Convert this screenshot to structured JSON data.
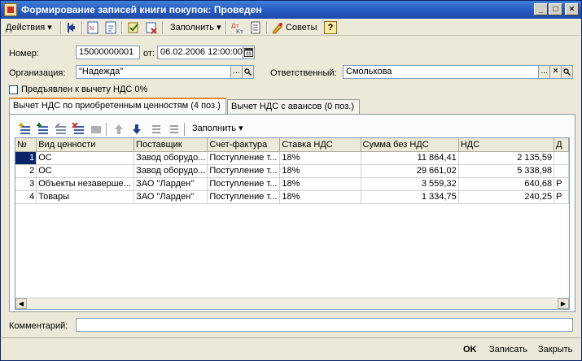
{
  "window": {
    "title": "Формирование записей книги покупок: Проведен",
    "controls": [
      "_",
      "□",
      "×"
    ]
  },
  "toolbar": {
    "actions_label": "Действия",
    "fill_label": "Заполнить",
    "tips_label": "Советы",
    "help_label": "?"
  },
  "header": {
    "number_label": "Номер:",
    "number_value": "15000000001",
    "date_label": "от:",
    "date_value": "06.02.2006 12:00:00",
    "org_label": "Организация:",
    "org_value": "\"Надежда\"",
    "responsible_label": "Ответственный:",
    "responsible_value": "Смолькова",
    "vat0_label": "Предъявлен к вычету НДС 0%",
    "ellipsis": "...",
    "clear": "×"
  },
  "tabs": [
    {
      "label": "Вычет НДС по приобретенным ценностям (4 поз.)"
    },
    {
      "label": "Вычет НДС с авансов (0 поз.)"
    }
  ],
  "inner_toolbar": {
    "fill_label": "Заполнить"
  },
  "table": {
    "columns": [
      "№",
      "Вид ценности",
      "Поставщик",
      "Счет-фактура",
      "Ставка НДС",
      "Сумма без НДС",
      "НДС",
      "Д"
    ],
    "rows": [
      {
        "n": "1",
        "kind": "ОС",
        "supplier": "Завод оборудо...",
        "invoice": "Поступление т...",
        "rate": "18%",
        "sum": "11 864,41",
        "vat": "2 135,59",
        "d": ""
      },
      {
        "n": "2",
        "kind": "ОС",
        "supplier": "Завод оборудо...",
        "invoice": "Поступление т...",
        "rate": "18%",
        "sum": "29 661,02",
        "vat": "5 338,98",
        "d": ""
      },
      {
        "n": "3",
        "kind": "Объекты незаверше...",
        "supplier": "ЗАО \"Ларден\"",
        "invoice": "Поступление т...",
        "rate": "18%",
        "sum": "3 559,32",
        "vat": "640,68",
        "d": "Р"
      },
      {
        "n": "4",
        "kind": "Товары",
        "supplier": "ЗАО \"Ларден\"",
        "invoice": "Поступление т...",
        "rate": "18%",
        "sum": "1 334,75",
        "vat": "240,25",
        "d": "Р"
      }
    ]
  },
  "comment_label": "Комментарий:",
  "comment_value": "",
  "footer": {
    "ok": "OK",
    "save": "Записать",
    "close": "Закрыть"
  },
  "colors": {
    "titlebar": "#2a5fc4",
    "selection": "#0a246a",
    "tab_accent": "#e68b2c"
  }
}
